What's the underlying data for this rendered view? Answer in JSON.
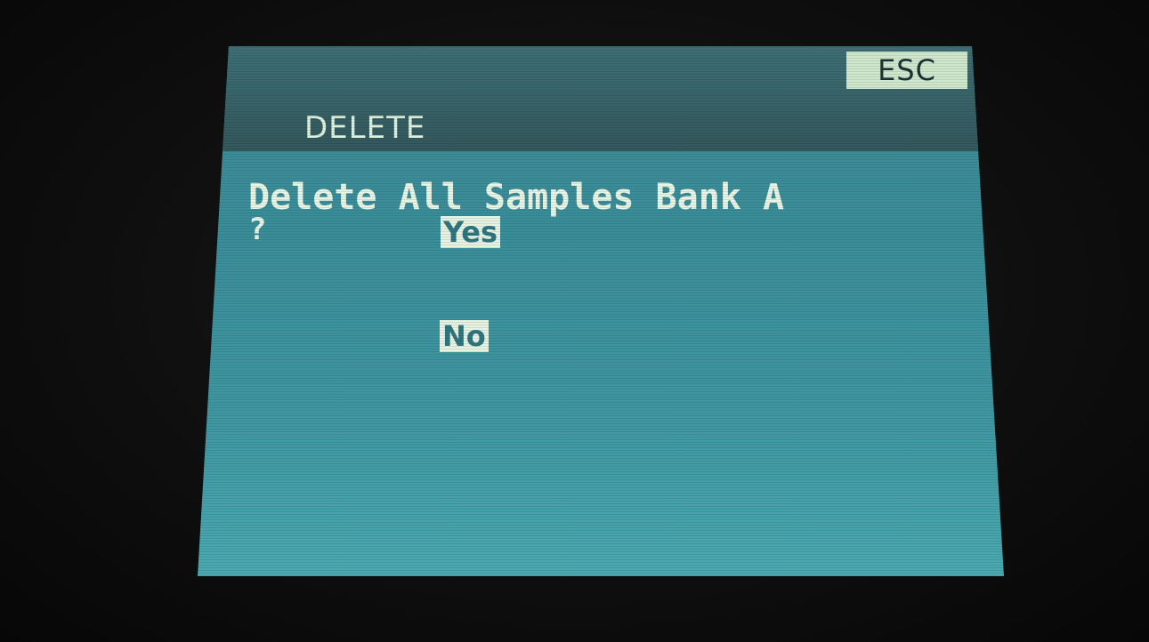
{
  "header": {
    "title": "DELETE",
    "esc_label": "ESC"
  },
  "dialog": {
    "prompt_line1": "Delete All Samples Bank A",
    "prompt_line2": "?",
    "options": [
      {
        "label": "Yes",
        "selected": true
      },
      {
        "label": "No",
        "selected": false
      }
    ]
  },
  "colors": {
    "screen": "#3f97a2",
    "header_bar": "#33585c",
    "highlight": "#e6f2e2",
    "text": "#e8f4e4"
  }
}
